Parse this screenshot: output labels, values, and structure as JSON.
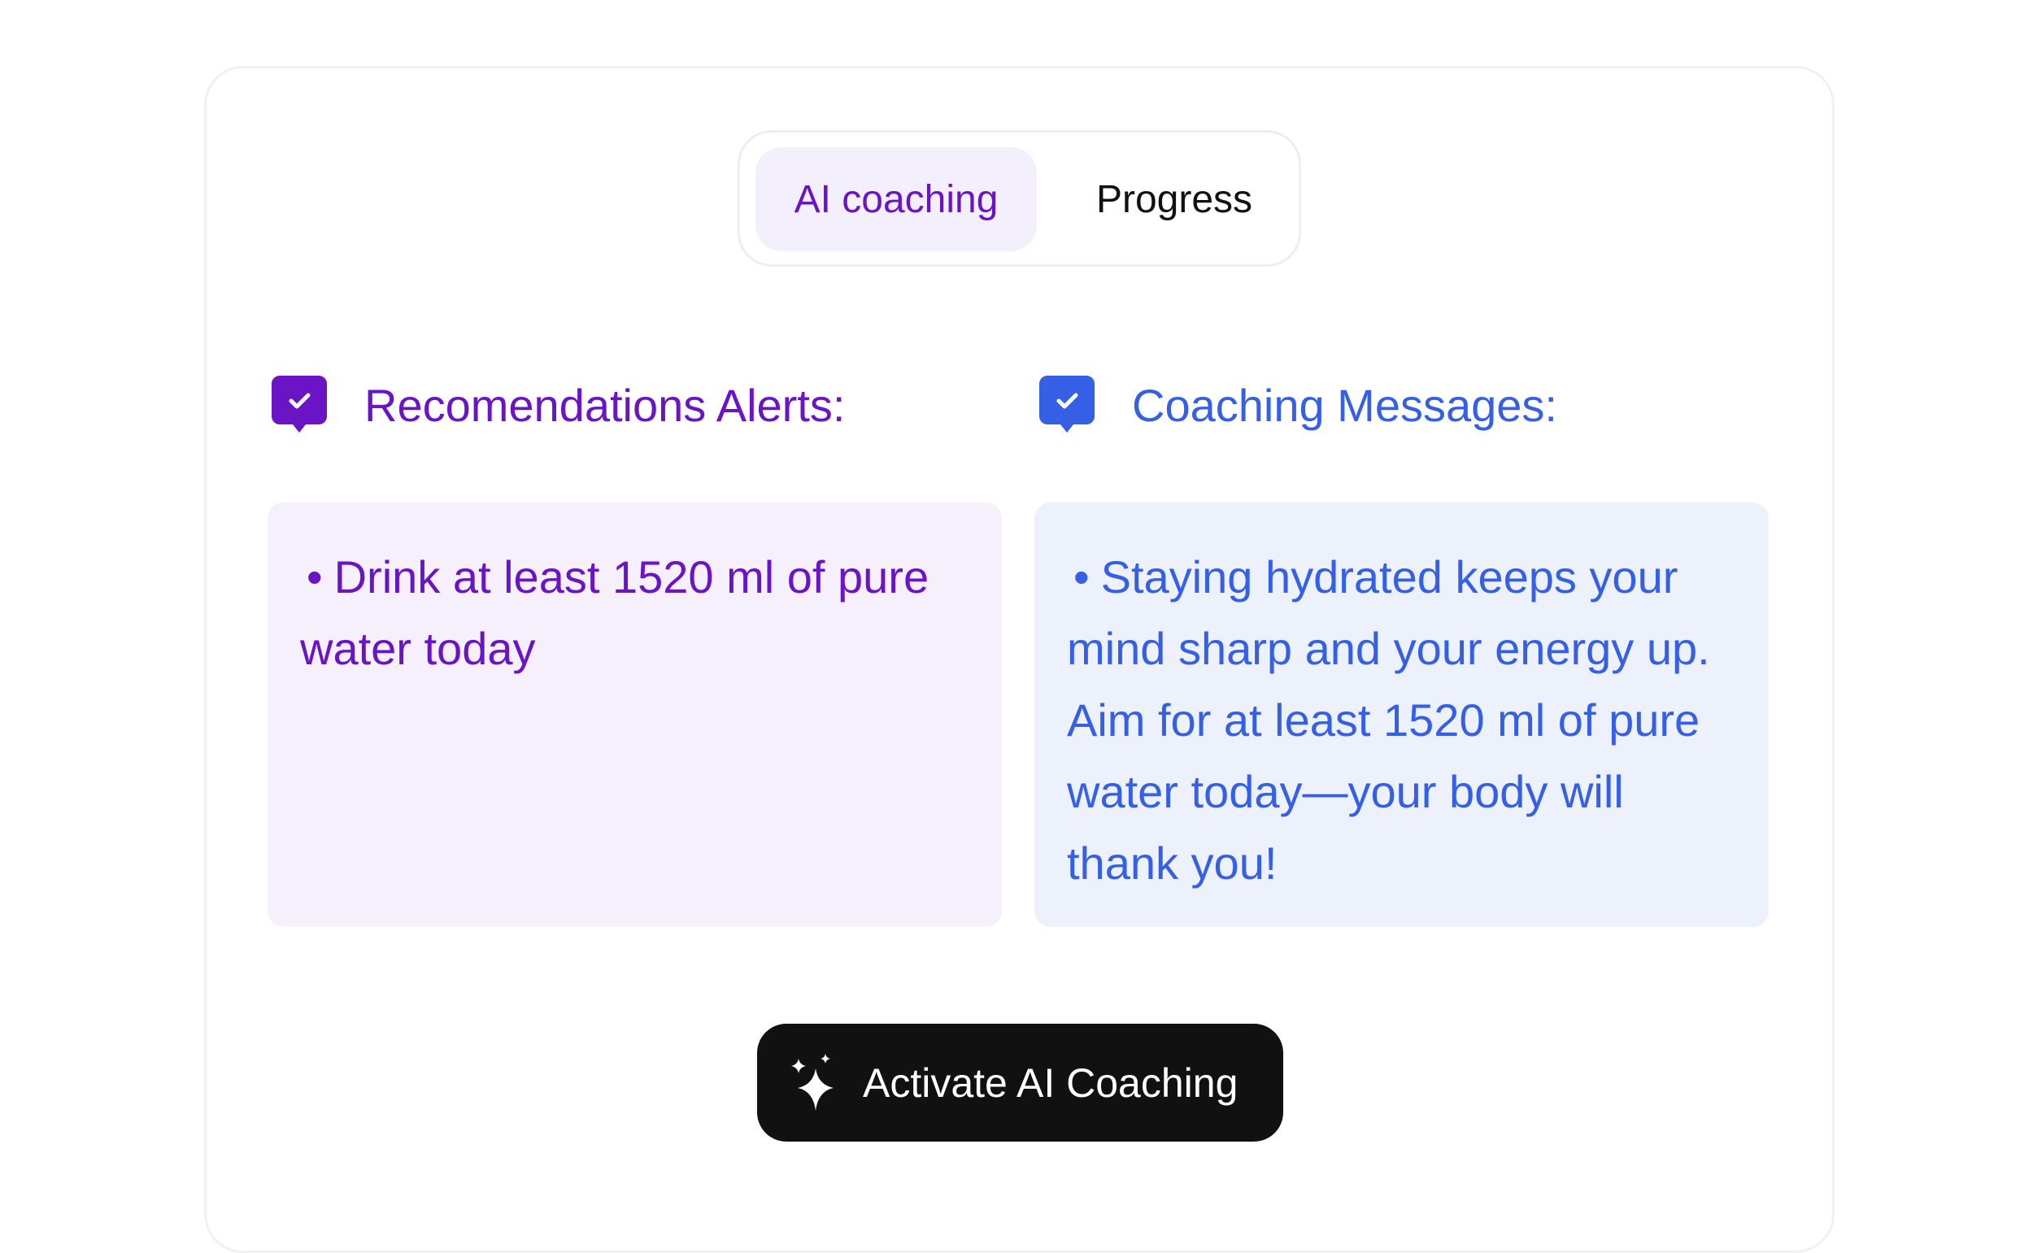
{
  "tabs": {
    "items": [
      {
        "label": "AI coaching",
        "active": true
      },
      {
        "label": "Progress",
        "active": false
      }
    ]
  },
  "recommendations": {
    "title": "Recomendations Alerts:",
    "icon": "chat-check-icon",
    "color": "#6a14c6",
    "bullet": "•",
    "text": "Drink at least 1520 ml of pure water today"
  },
  "coaching": {
    "title": "Coaching Messages:",
    "icon": "chat-check-icon",
    "color": "#3560e6",
    "bullet": "•",
    "text": "Staying hydrated keeps your mind sharp and your energy up. Aim for at least 1520 ml of pure water today—your body will thank you!"
  },
  "action": {
    "label": "Activate AI Coaching",
    "icon": "sparkle-icon"
  }
}
